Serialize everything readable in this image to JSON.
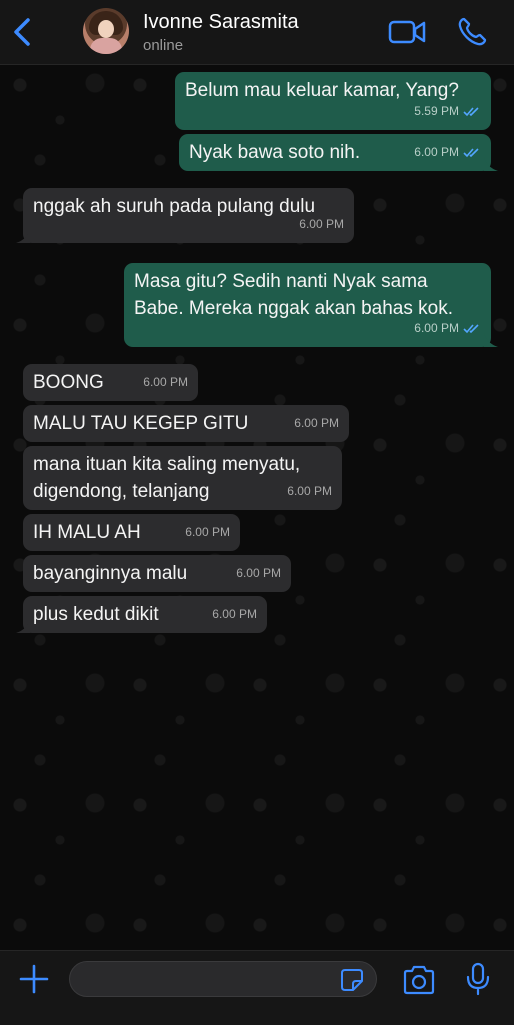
{
  "header": {
    "contact_name": "Ivonne Sarasmita",
    "status": "online",
    "back_icon": "chevron-left-icon",
    "video_icon": "video-camera-icon",
    "call_icon": "phone-icon"
  },
  "colors": {
    "accent": "#3d8bff",
    "outgoing_bubble": "#1f5c4b",
    "incoming_bubble": "#2c2c2e",
    "read_ticks": "#53a6ff"
  },
  "messages": [
    {
      "dir": "out",
      "text": "Belum mau keluar kamar, Yang?",
      "time": "5.59 PM",
      "read": true
    },
    {
      "dir": "out",
      "text": "Nyak bawa soto nih.",
      "time": "6.00 PM",
      "read": true
    },
    {
      "dir": "in",
      "text": "nggak ah suruh pada pulang dulu",
      "time": "6.00 PM"
    },
    {
      "dir": "out",
      "text": "Masa gitu? Sedih nanti Nyak sama\nBabe. Mereka nggak akan bahas kok.",
      "time": "6.00 PM",
      "read": true
    },
    {
      "dir": "in",
      "text": "BOONG",
      "time": "6.00 PM"
    },
    {
      "dir": "in",
      "text": "MALU TAU KEGEP GITU",
      "time": "6.00 PM"
    },
    {
      "dir": "in",
      "text": "mana ituan kita saling menyatu,\ndigendong, telanjang",
      "time": "6.00 PM"
    },
    {
      "dir": "in",
      "text": "IH MALU AH",
      "time": "6.00 PM"
    },
    {
      "dir": "in",
      "text": "bayanginnya malu",
      "time": "6.00 PM"
    },
    {
      "dir": "in",
      "text": "plus kedut dikit",
      "time": "6.00 PM"
    }
  ],
  "input": {
    "value": "",
    "placeholder": "",
    "plus_icon": "plus-icon",
    "sticker_icon": "sticker-icon",
    "camera_icon": "camera-icon",
    "mic_icon": "microphone-icon"
  }
}
